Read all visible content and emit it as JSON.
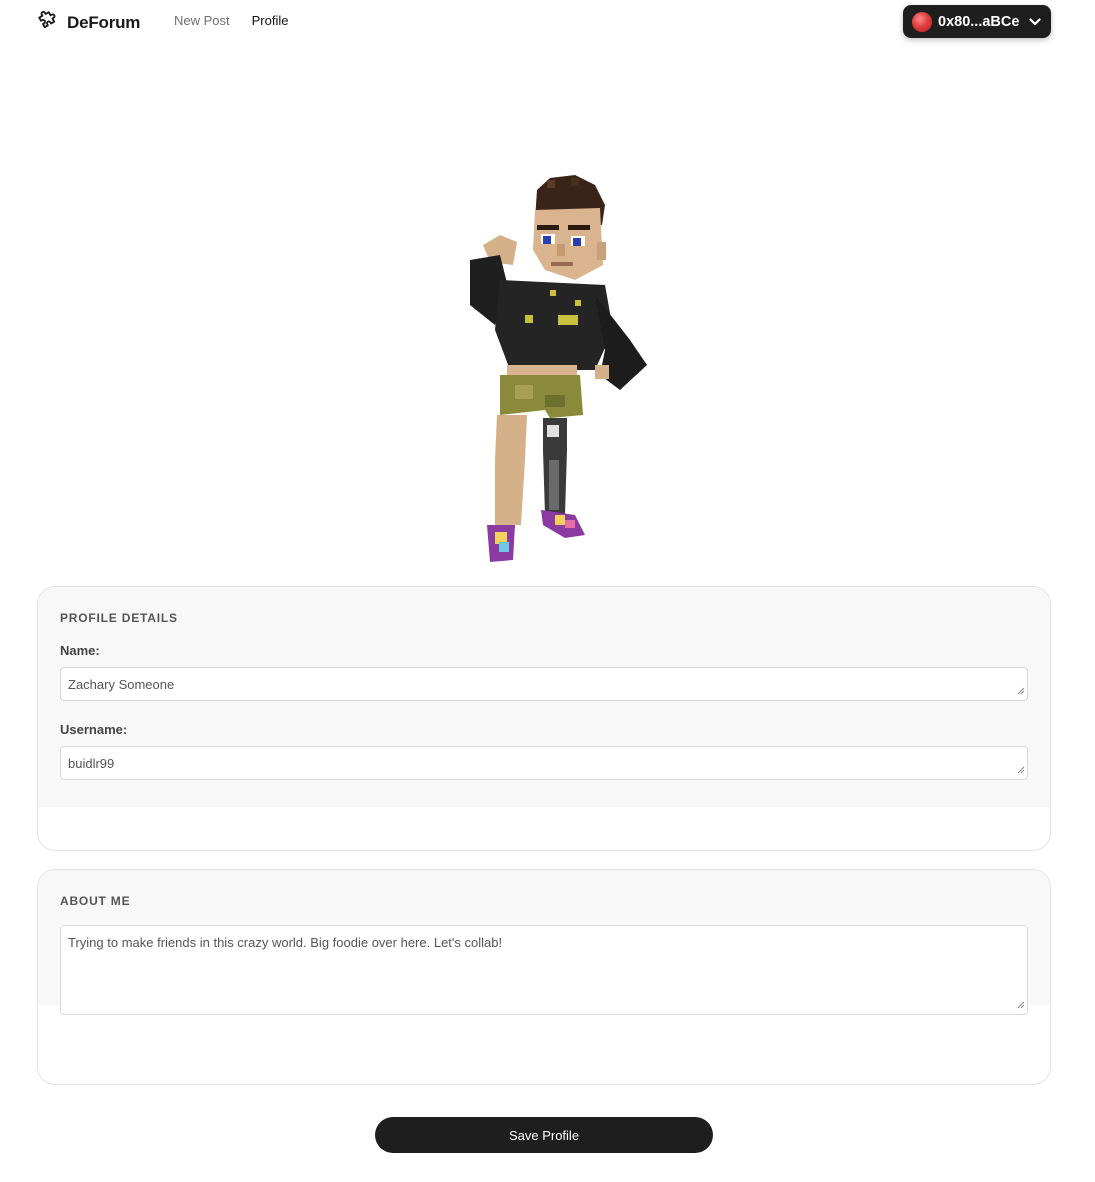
{
  "header": {
    "brand": "DeForum",
    "logo_icon": "puzzle-icon",
    "nav": [
      {
        "label": "New Post",
        "active": false
      },
      {
        "label": "Profile",
        "active": true
      }
    ],
    "wallet": {
      "address": "0x80...aBCe",
      "icon": "chevron-down-icon",
      "avatar_color": "#e03e3e"
    }
  },
  "profile_details": {
    "title": "PROFILE DETAILS",
    "name_label": "Name:",
    "name_value": "Zachary Someone",
    "username_label": "Username:",
    "username_value": "buidlr99"
  },
  "about": {
    "title": "ABOUT ME",
    "text": "Trying to make friends in this crazy world. Big foodie over here. Let's collab!"
  },
  "actions": {
    "save_label": "Save Profile"
  },
  "colors": {
    "primary": "#1e1e1e",
    "card_bg": "#f8f8f8",
    "border": "#e3e3e3"
  }
}
